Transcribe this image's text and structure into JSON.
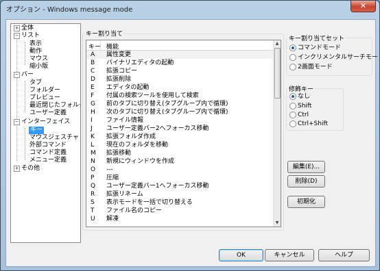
{
  "window": {
    "title": "オプション - Windows message mode",
    "close_glyph": "✕"
  },
  "tree": {
    "expander_glyph": "⊟",
    "items": [
      {
        "label": "全体"
      },
      {
        "label": "リスト"
      },
      {
        "label": "表示"
      },
      {
        "label": "動作"
      },
      {
        "label": "マウス"
      },
      {
        "label": "縮小版"
      },
      {
        "label": "バー"
      },
      {
        "label": "タブ"
      },
      {
        "label": "フォルダー"
      },
      {
        "label": "プレビュー"
      },
      {
        "label": "最近閉じたフォルダ"
      },
      {
        "label": "ユーザー定義"
      },
      {
        "label": "インターフェイス"
      },
      {
        "label": "キー",
        "selected": true
      },
      {
        "label": "マウスジェスチャ"
      },
      {
        "label": "外部コマンド"
      },
      {
        "label": "コマンド定義"
      },
      {
        "label": "メニュー定義"
      },
      {
        "label": "その他"
      }
    ]
  },
  "key_assign": {
    "group_label": "キー割り当て",
    "col_key": "キー",
    "col_func": "機能",
    "rows": [
      {
        "key": "A",
        "func": "属性変更"
      },
      {
        "key": "B",
        "func": "バイナリエディタの起動"
      },
      {
        "key": "C",
        "func": "拡張コピー"
      },
      {
        "key": "D",
        "func": "拡張削除"
      },
      {
        "key": "E",
        "func": "エディタの起動"
      },
      {
        "key": "F",
        "func": "付属の検索ツールを使用して検索"
      },
      {
        "key": "G",
        "func": "前のタブに切り替え(タブグループ内で循環)"
      },
      {
        "key": "H",
        "func": "次のタブに切り替え(タブグループ内で循環)"
      },
      {
        "key": "I",
        "func": "ファイル情報"
      },
      {
        "key": "J",
        "func": "ユーザー定義バー2へフォーカス移動"
      },
      {
        "key": "K",
        "func": "拡張フォルダ作成"
      },
      {
        "key": "L",
        "func": "現在のフォルダを移動"
      },
      {
        "key": "M",
        "func": "拡張移動"
      },
      {
        "key": "N",
        "func": "新規にウィンドウを作成"
      },
      {
        "key": "O",
        "func": "---"
      },
      {
        "key": "P",
        "func": "圧縮"
      },
      {
        "key": "Q",
        "func": "ユーザー定義バー1へフォーカス移動"
      },
      {
        "key": "R",
        "func": "拡張リネーム"
      },
      {
        "key": "S",
        "func": "表示モードを一括で切り替える"
      },
      {
        "key": "T",
        "func": "ファイル名のコピー"
      },
      {
        "key": "U",
        "func": "解凍"
      }
    ]
  },
  "key_set": {
    "group_label": "キー割り当てセット",
    "options": [
      {
        "label": "コマンドモード",
        "checked": true
      },
      {
        "label": "インクリメンタルサーチモード",
        "checked": false
      },
      {
        "label": "2画面モード",
        "checked": false
      }
    ]
  },
  "modifier": {
    "group_label": "修飾キー",
    "options": [
      {
        "label": "なし",
        "checked": true
      },
      {
        "label": "Shift",
        "checked": false
      },
      {
        "label": "Ctrl",
        "checked": false
      },
      {
        "label": "Ctrl+Shift",
        "checked": false
      }
    ]
  },
  "buttons": {
    "edit": "編集(E)...",
    "delete": "削除(D)",
    "reset": "初期化",
    "ok": "OK",
    "cancel": "キャンセル",
    "help": "ヘルプ"
  }
}
